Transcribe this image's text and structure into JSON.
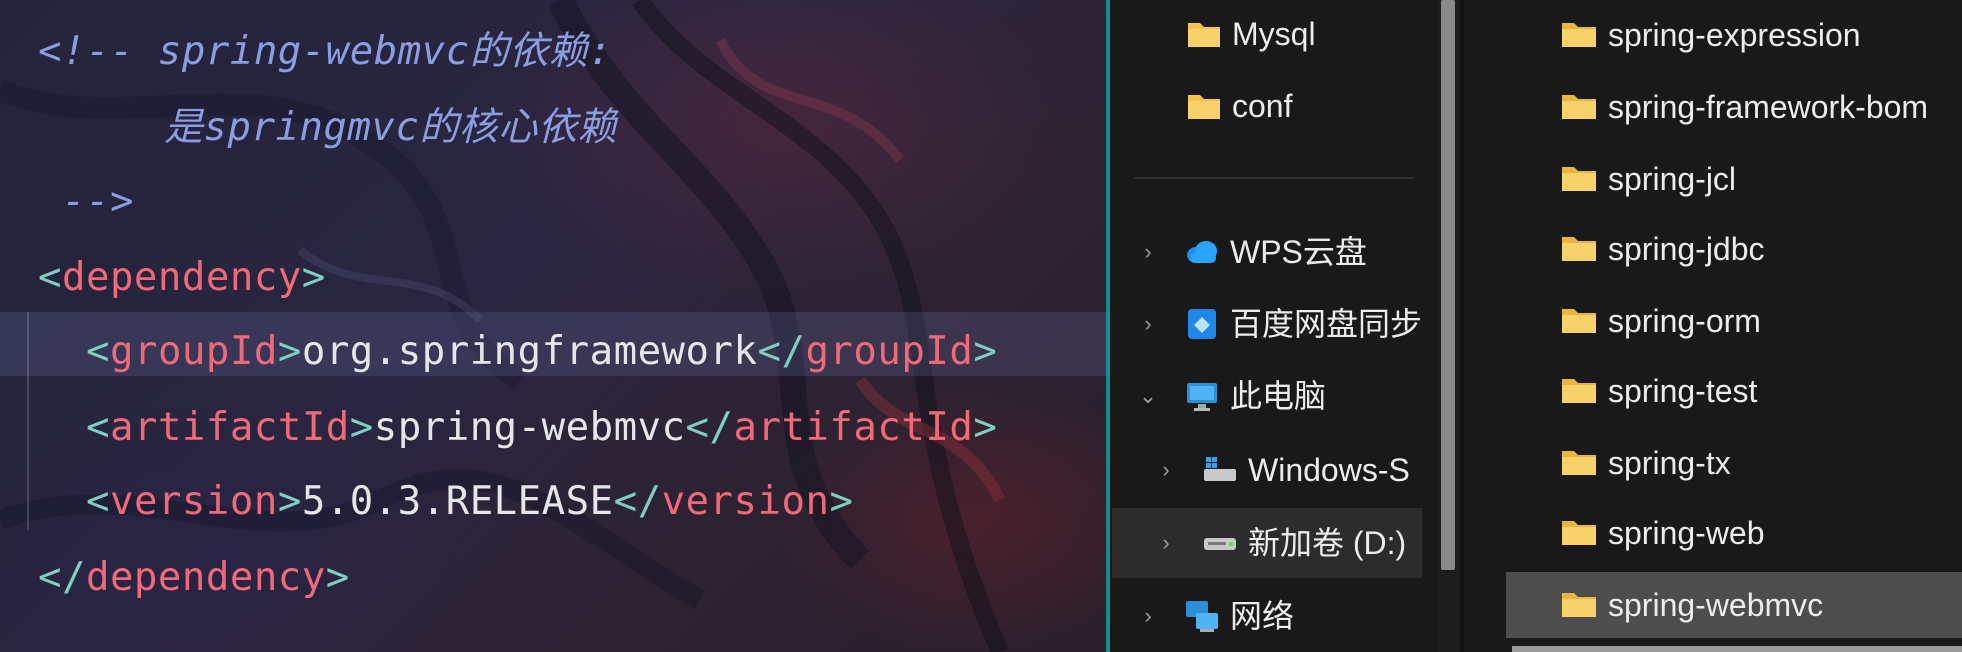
{
  "editor": {
    "comment_open": "<!-- spring-webmvc的依赖:",
    "comment_body": "是springmvc的核心依赖",
    "comment_close": "-->",
    "lines": [
      {
        "lt": "<",
        "tag": "dependency",
        "gt": ">"
      },
      {
        "lt": "<",
        "tag": "groupId",
        "gt": ">",
        "text": "org.springframework",
        "clt": "</",
        "ctag": "groupId",
        "cgt": ">"
      },
      {
        "lt": "<",
        "tag": "artifactId",
        "gt": ">",
        "text": "spring-webmvc",
        "clt": "</",
        "ctag": "artifactId",
        "cgt": ">"
      },
      {
        "lt": "<",
        "tag": "version",
        "gt": ">",
        "text": "5.0.3.RELEASE",
        "clt": "</",
        "ctag": "version",
        "cgt": ">"
      },
      {
        "lt": "</",
        "tag": "dependency",
        "gt": ">"
      }
    ],
    "colors": {
      "comment": "#8a9de0",
      "bracket": "#7ccfc1",
      "tag": "#ef6a79",
      "text": "#e6e6ea",
      "accent_edge": "#0f8f91"
    }
  },
  "navigation": {
    "items": [
      {
        "label": "Mysql",
        "icon": "folder-icon",
        "chevron": ""
      },
      {
        "label": "conf",
        "icon": "folder-icon",
        "chevron": ""
      },
      {
        "label": "WPS云盘",
        "icon": "cloud-icon",
        "chevron": "›"
      },
      {
        "label": "百度网盘同步",
        "icon": "baidu-netdisk-icon",
        "chevron": "›"
      },
      {
        "label": "此电脑",
        "icon": "computer-icon",
        "chevron": "⌄"
      },
      {
        "label": "Windows-S",
        "icon": "system-drive-icon",
        "chevron": "›"
      },
      {
        "label": "新加卷 (D:)",
        "icon": "drive-icon",
        "chevron": "›"
      },
      {
        "label": "网络",
        "icon": "network-icon",
        "chevron": "›"
      }
    ],
    "selected": "新加卷 (D:)"
  },
  "file_list": {
    "items": [
      "spring-expression",
      "spring-framework-bom",
      "spring-jcl",
      "spring-jdbc",
      "spring-orm",
      "spring-test",
      "spring-tx",
      "spring-web",
      "spring-webmvc"
    ],
    "selected": "spring-webmvc",
    "item_icon": "folder-icon",
    "folder_color": "#f2c14e"
  }
}
